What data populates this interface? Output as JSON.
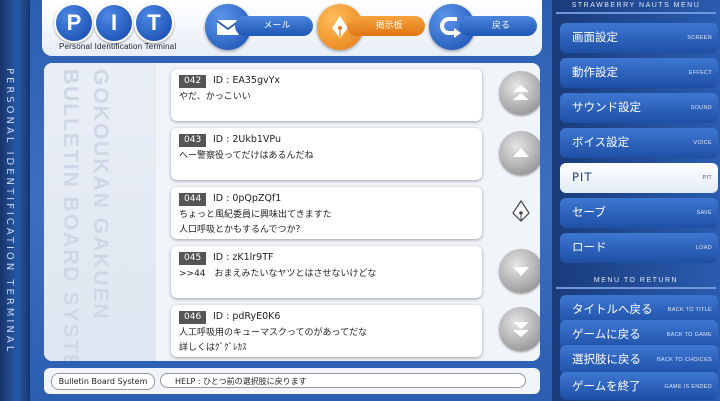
{
  "left_strip": {
    "text": "PERSONAL IDENTIFICATION TERMINAL"
  },
  "header": {
    "logo_letters": [
      "P",
      "I",
      "T"
    ],
    "logo_subtitle": "Personal Identification Terminal",
    "buttons": [
      {
        "label": "メール",
        "icon": "envelope-icon",
        "active": false
      },
      {
        "label": "掲示板",
        "icon": "pen-nib-icon",
        "active": true
      },
      {
        "label": "戻る",
        "icon": "back-arrow-icon",
        "active": false
      }
    ]
  },
  "side_title": [
    "GOKOUKAN GAKUEN",
    "BULLETIN BOARD SYSTEM"
  ],
  "messages": [
    {
      "num": "042",
      "id": "ID : EA35gvYx",
      "line1": "やだ、かっこいい",
      "line2": ""
    },
    {
      "num": "043",
      "id": "ID : 2Ukb1VPu",
      "line1": "へー警察役ってだけはあるんだね",
      "line2": ""
    },
    {
      "num": "044",
      "id": "ID : 0pQpZQf1",
      "line1": "ちょっと風紀委員に興味出てきますた",
      "line2": "人口呼吸とかもするんでつか？"
    },
    {
      "num": "045",
      "id": "ID : zK1lr9TF",
      "line1": ">>44　おまえみたいなヤツとはさせないけどな",
      "line2": ""
    },
    {
      "num": "046",
      "id": "ID : pdRyE0K6",
      "line1": "人工呼吸用のキューマスクってのがあってだな",
      "line2": "詳しくはｸﾞｸﾞﾚｶｽ"
    }
  ],
  "footer": {
    "title": "Bulletin Board System",
    "help": "HELP : ひとつ前の選択肢に戻ります"
  },
  "menu": {
    "header_top": "STRAWBERRY NAUTS MENU",
    "header_return": "MENU TO RETURN",
    "items": [
      {
        "jp": "画面設定",
        "en": "SCREEN"
      },
      {
        "jp": "動作設定",
        "en": "EFFECT"
      },
      {
        "jp": "サウンド設定",
        "en": "SOUND"
      },
      {
        "jp": "ボイス設定",
        "en": "VOICE"
      },
      {
        "jp": "PIT",
        "en": "PIT"
      },
      {
        "jp": "セーブ",
        "en": "SAVE"
      },
      {
        "jp": "ロード",
        "en": "LOAD"
      }
    ],
    "return_items": [
      {
        "jp": "タイトルへ戻る",
        "en": "BACK TO TITLE"
      },
      {
        "jp": "ゲームに戻る",
        "en": "BACK TO GAME"
      },
      {
        "jp": "選択肢に戻る",
        "en": "BACK TO CHOICES"
      },
      {
        "jp": "ゲームを終了",
        "en": "GAME IS ENDED"
      }
    ],
    "selected": "PIT"
  },
  "colors": {
    "accent": "#f08b1d",
    "panel": "#f1f4f9",
    "menu_blue": "#2a5cb0"
  }
}
